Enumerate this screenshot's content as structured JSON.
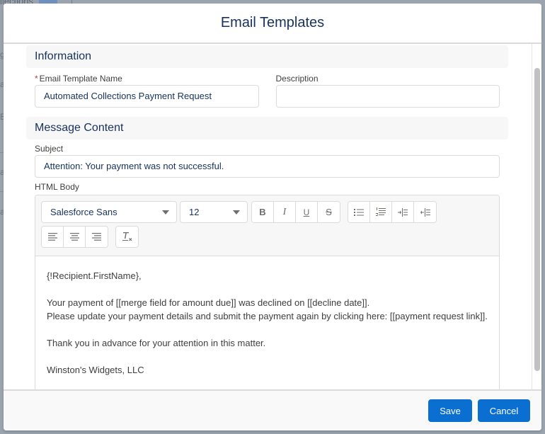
{
  "background": {
    "partial_text": "llections",
    "side_fragments": [
      "g",
      "a",
      "E",
      "a",
      "a"
    ]
  },
  "modal": {
    "title": "Email Templates"
  },
  "information": {
    "section_title": "Information",
    "name_field": {
      "label": "Email Template Name",
      "required_marker": "*",
      "value": "Automated Collections Payment Request"
    },
    "description_field": {
      "label": "Description",
      "value": ""
    }
  },
  "message_content": {
    "section_title": "Message Content",
    "subject_field": {
      "label": "Subject",
      "value": "Attention: Your payment was not successful."
    },
    "html_body": {
      "label": "HTML Body",
      "toolbar": {
        "font_family": "Salesforce Sans",
        "font_size": "12",
        "format_buttons": [
          "bold",
          "italic",
          "underline",
          "strikethrough"
        ],
        "list_buttons": [
          "bulleted-list",
          "numbered-list",
          "indent",
          "outdent"
        ],
        "align_buttons": [
          "align-left",
          "align-center",
          "align-right"
        ],
        "clear_format": "remove-formatting",
        "bold_glyph": "B",
        "italic_glyph": "I",
        "underline_glyph": "U",
        "strike_glyph": "S"
      },
      "lines": [
        "{!Recipient.FirstName},",
        "",
        "Your payment of [[merge field for amount due]] was declined on [[decline date]].",
        "Please update your payment details and submit the payment again by clicking here: [[payment request link]].",
        "",
        "Thank you in advance for your attention in this matter.",
        "",
        "Winston's Widgets, LLC"
      ]
    }
  },
  "footer": {
    "save_label": "Save",
    "cancel_label": "Cancel"
  },
  "colors": {
    "brand": "#0b6fd2",
    "title_text": "#16325c",
    "required": "#c23934",
    "overlay": "#9aa3ae"
  }
}
